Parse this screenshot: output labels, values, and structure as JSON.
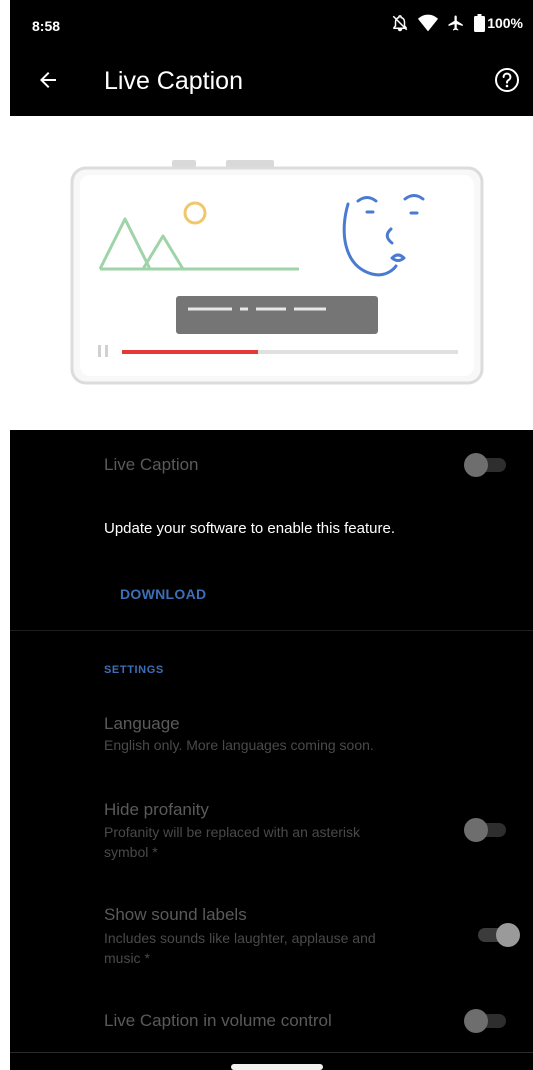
{
  "status_bar": {
    "time": "8:58",
    "battery": "100%",
    "icons": [
      "mute-off-icon",
      "wifi-icon",
      "airplane-icon",
      "battery-icon"
    ]
  },
  "app_bar": {
    "title": "Live Caption",
    "back_icon": "arrow-back-icon",
    "help_icon": "help-circle-icon"
  },
  "main_toggle": {
    "label": "Live Caption",
    "state": "off"
  },
  "update": {
    "message": "Update your software to enable this feature.",
    "download_label": "DOWNLOAD"
  },
  "settings": {
    "header": "SETTINGS",
    "language": {
      "title": "Language",
      "summary": "English only. More languages coming soon."
    },
    "hide_profanity": {
      "title": "Hide profanity",
      "summary_line1": "Profanity will be replaced with an asterisk",
      "summary_line2": "symbol *",
      "state": "off"
    },
    "sound_labels": {
      "title": "Show sound labels",
      "summary_line1": "Includes sounds like laughter, applause and",
      "summary_line2": "music *",
      "state": "on"
    },
    "volume_control": {
      "title": "Live Caption in volume control",
      "state": "off"
    }
  },
  "colors": {
    "accent": "#3d6fb8",
    "progress": "#e53935",
    "mountain": "#9fd3a8",
    "sun": "#f0c76a",
    "face": "#4a7bd0"
  }
}
